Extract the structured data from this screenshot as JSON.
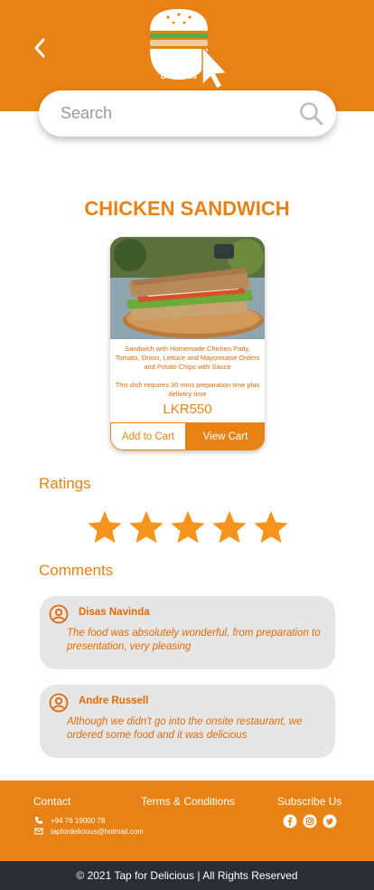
{
  "header": {
    "logo_line1": "Tap",
    "logo_line2": "Delicious",
    "back_icon": "chevron-left-icon"
  },
  "search": {
    "placeholder": "Search",
    "value": "",
    "icon": "search-icon"
  },
  "dish": {
    "title": "CHICKEN SANDWICH",
    "description": "Sandwich with Homemade Chicken Patty, Tomato, Onion, Lettuce and Mayonnaise Orders and Potato Chips with Sauce",
    "prep_note": "This dish requires 30 mins preparation time plus delivery time",
    "price": "LKR550",
    "add_to_cart_label": "Add to Cart",
    "view_cart_label": "View Cart"
  },
  "ratings": {
    "heading": "Ratings",
    "stars": 5,
    "max_stars": 5
  },
  "comments": {
    "heading": "Comments",
    "items": [
      {
        "name": "Disas Navinda",
        "text": "The food was absolutely wonderful, from preparation to presentation, very pleasing"
      },
      {
        "name": "Andre Russell",
        "text": "Although we didn't go into the onsite restaurant, we ordered some food and it was delicious"
      }
    ]
  },
  "footer": {
    "contact_heading": "Contact",
    "terms_label": "Terms & Conditions",
    "subscribe_heading": "Subscribe Us",
    "phone": "+94 76 19000 78",
    "email": "tapfordelicious@hotmail.com",
    "social_icons": [
      "facebook-icon",
      "instagram-icon",
      "twitter-icon"
    ],
    "copyright": "© 2021 Tap for Delicious | All Rights Reserved"
  },
  "colors": {
    "brand_orange": "#e88215",
    "text_orange": "#e06a0a",
    "comment_bg": "#e6e6e6",
    "bottom_bar": "#2b2d34",
    "star": "#f7941d"
  }
}
